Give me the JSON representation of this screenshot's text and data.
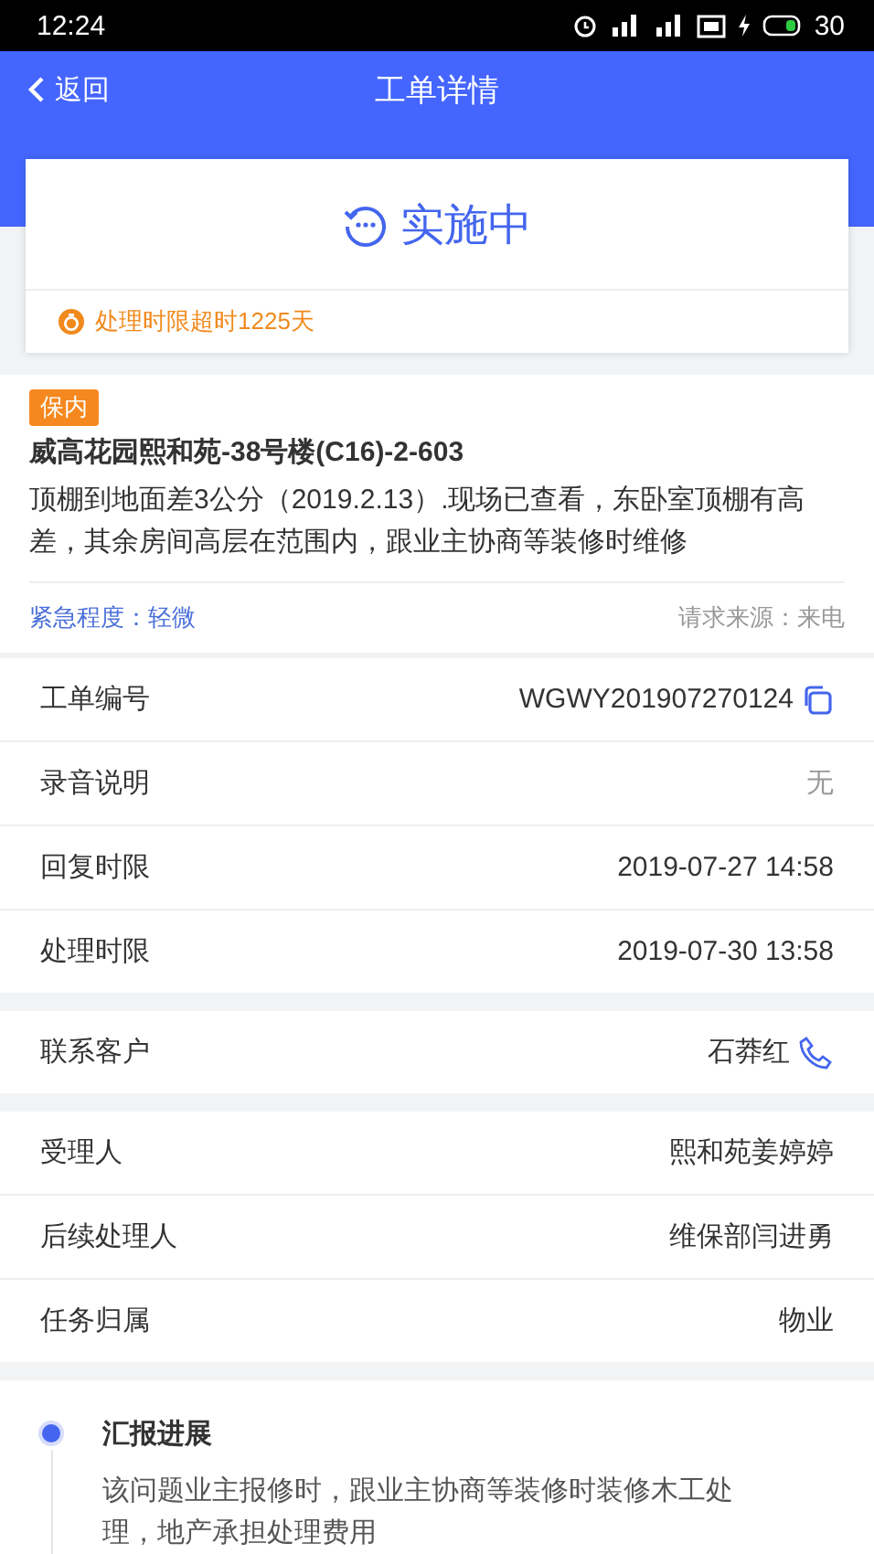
{
  "status_bar": {
    "time": "12:24",
    "battery": "30"
  },
  "header": {
    "back": "返回",
    "title": "工单详情"
  },
  "status_card": {
    "status": "实施中",
    "warning": "处理时限超时1225天"
  },
  "order": {
    "tag": "保内",
    "address": "威高花园熙和苑-38号楼(C16)-2-603",
    "description": "顶棚到地面差3公分（2019.2.13）.现场已查看，东卧室顶棚有高差，其余房间高层在范围内，跟业主协商等装修时维修",
    "urgency": "紧急程度：轻微",
    "source": "请求来源：来电"
  },
  "sections": [
    [
      {
        "label": "工单编号",
        "value": "WGWY201907270124",
        "kind": "copy"
      },
      {
        "label": "录音说明",
        "value": "无",
        "kind": "muted"
      },
      {
        "label": "回复时限",
        "value": "2019-07-27 14:58",
        "kind": "plain"
      },
      {
        "label": "处理时限",
        "value": "2019-07-30 13:58",
        "kind": "plain"
      }
    ],
    [
      {
        "label": "联系客户",
        "value": "石莽红",
        "kind": "phone"
      }
    ],
    [
      {
        "label": "受理人",
        "value": "熙和苑姜婷婷",
        "kind": "plain"
      },
      {
        "label": "后续处理人",
        "value": "维保部闫进勇",
        "kind": "plain"
      },
      {
        "label": "任务归属",
        "value": "物业",
        "kind": "plain"
      }
    ]
  ],
  "timeline": [
    {
      "title": "汇报进展",
      "text": "该问题业主报修时，跟业主协商等装修时装修木工处理，地产承担处理费用"
    }
  ]
}
